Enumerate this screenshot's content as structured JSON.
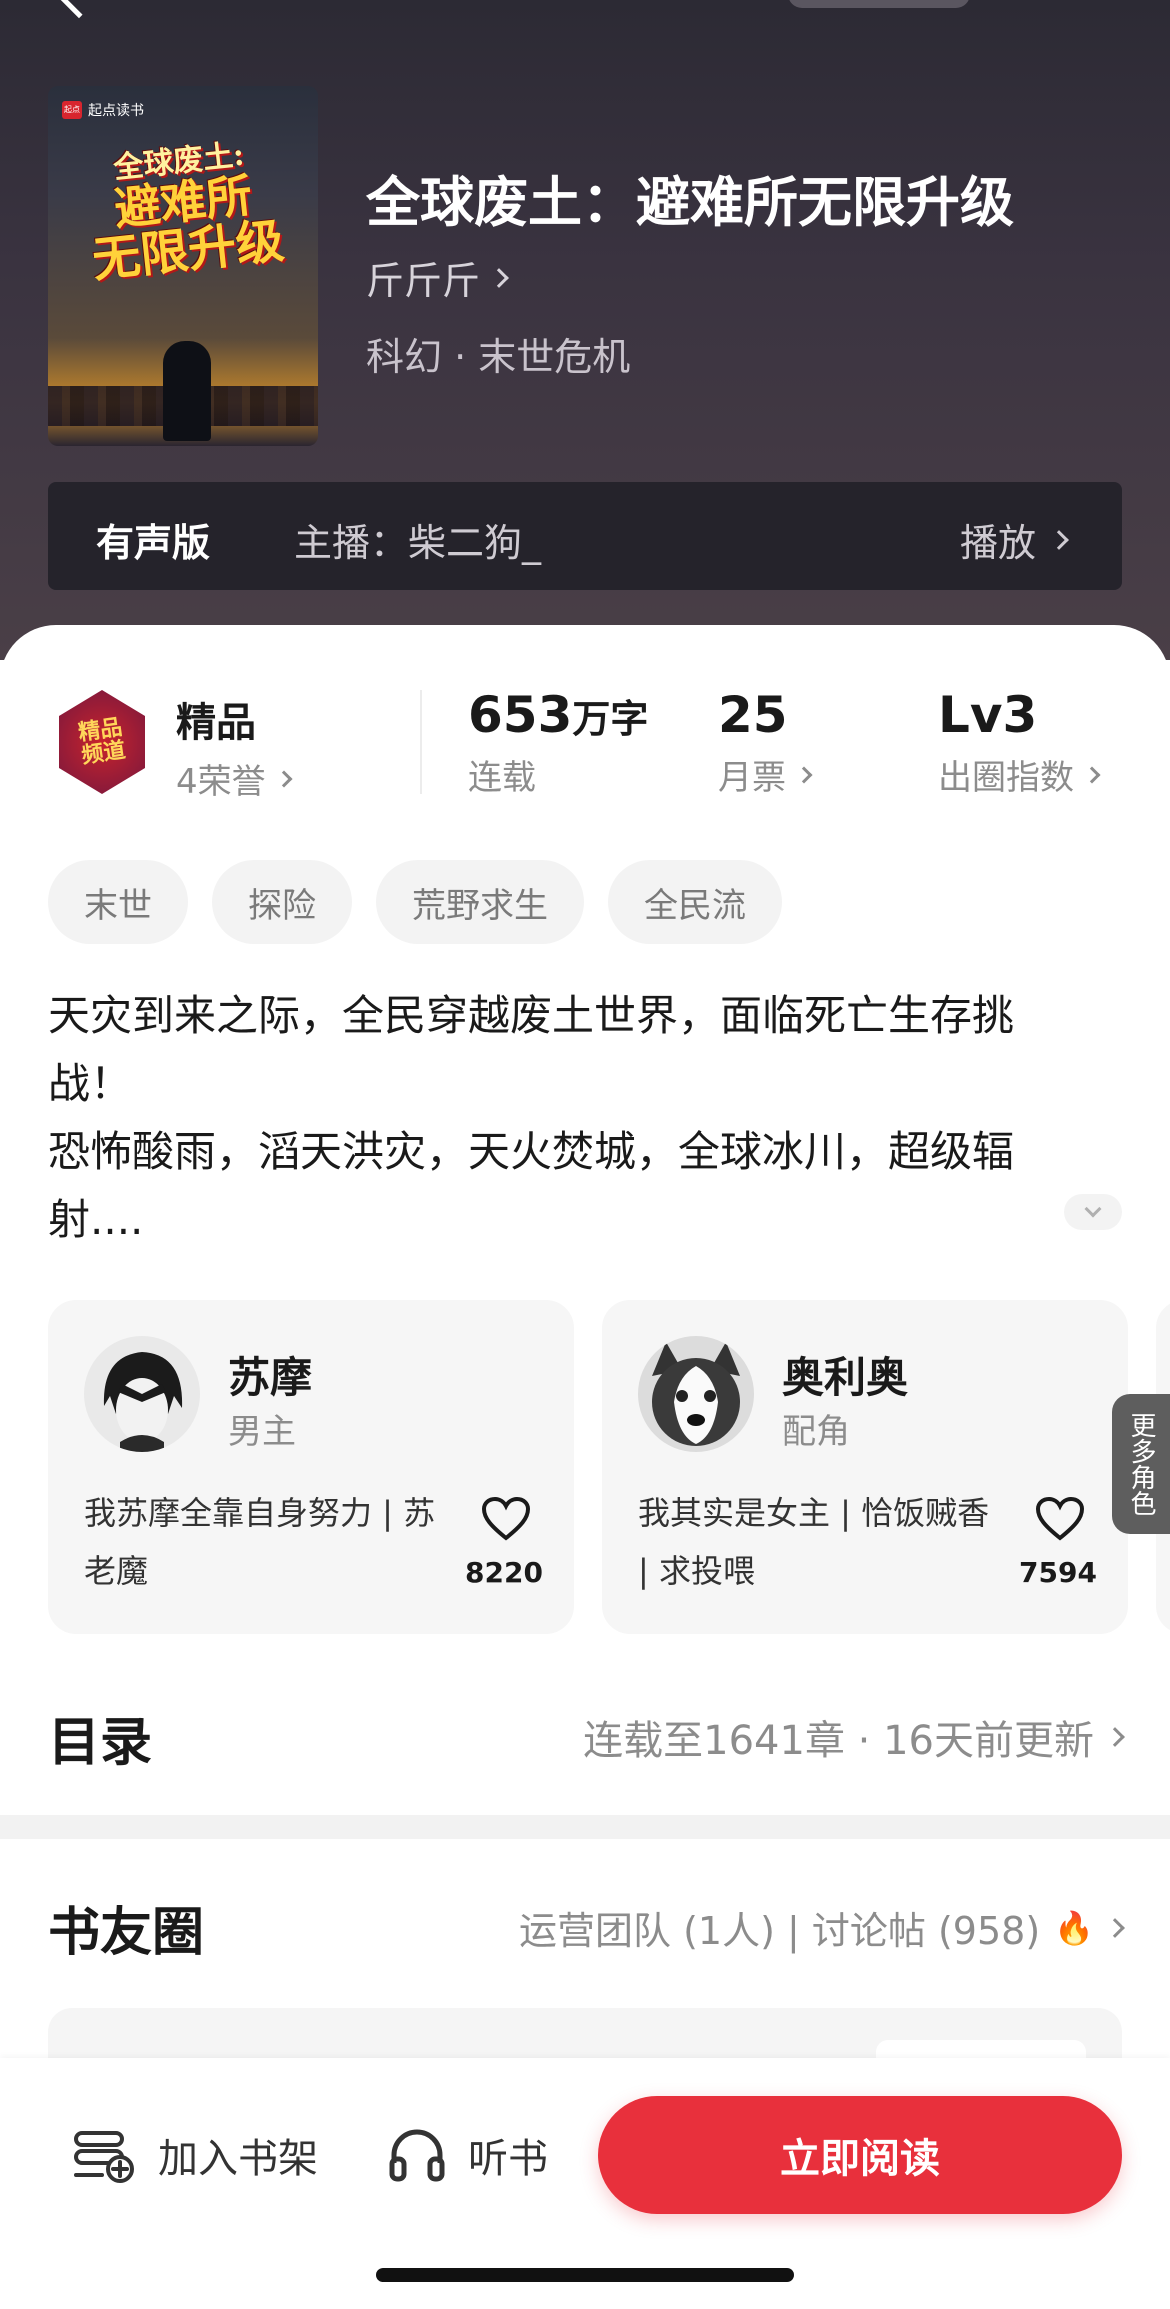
{
  "book": {
    "cover": {
      "publisher": "起点读书",
      "publisher_logo": "起点",
      "title_line1": "全球废土:",
      "title_line2": "避难所",
      "title_line3": "无限升级"
    },
    "title": "全球废土：避难所无限升级",
    "author": "斤斤斤",
    "genre": "科幻 · 末世危机"
  },
  "audio": {
    "tag": "有声版",
    "host": "主播：柴二狗_",
    "play": "播放"
  },
  "honor": {
    "badge_text_1": "精品",
    "badge_text_2": "频道",
    "title": "精品",
    "sub": "4荣誉"
  },
  "stats": {
    "words_num": "653",
    "words_unit": "万字",
    "words_label": "连载",
    "tickets_num": "25",
    "tickets_label": "月票",
    "level_num": "Lv3",
    "level_label": "出圈指数"
  },
  "tags": [
    "末世",
    "探险",
    "荒野求生",
    "全民流"
  ],
  "synopsis": {
    "line1": "天灾到来之际，全民穿越废土世界，面临死亡生存挑",
    "line2": "战！",
    "line3": "恐怖酸雨，滔天洪灾，天火焚城，全球冰川，超级辐",
    "line4": "射...."
  },
  "characters": [
    {
      "name": "苏摩",
      "role": "男主",
      "desc": "我苏摩全靠自身努力 | 苏老魔",
      "likes": "8220"
    },
    {
      "name": "奥利奥",
      "role": "配角",
      "desc": "我其实是女主 | 恰饭贼香 | 求投喂",
      "likes": "7594"
    }
  ],
  "more_roles": "更多角色",
  "toc": {
    "title": "目录",
    "info": "连载至1641章 · 16天前更新"
  },
  "circle": {
    "title": "书友圈",
    "info": "运营团队 (1人) | 讨论帖 (958)"
  },
  "bottom": {
    "shelf": "加入书架",
    "listen": "听书",
    "read": "立即阅读"
  },
  "colors": {
    "accent": "#e8303c",
    "hero_bg": "#3a3340"
  }
}
